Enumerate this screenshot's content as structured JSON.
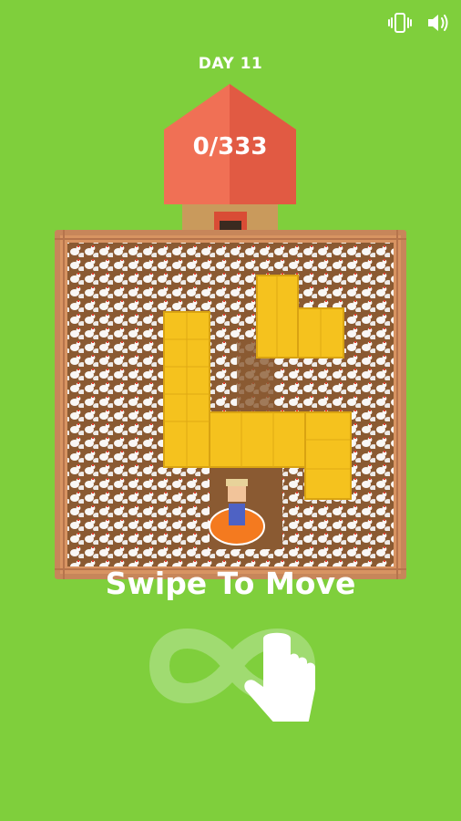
{
  "hud": {
    "day_label": "DAY 11",
    "collected_count": "0/333",
    "icons": [
      "vibrate-icon",
      "sound-icon"
    ]
  },
  "tutorial": {
    "instruction": "Swipe To Move",
    "gesture_icon": "swipe-hand-infinity-icon"
  },
  "colors": {
    "grass": "#7fcf3c",
    "dirt": "#8a5a32",
    "roof": "#e8614a",
    "hay": "#f5c21e",
    "player_ring": "#f47a1f",
    "fence": "#d89462"
  }
}
